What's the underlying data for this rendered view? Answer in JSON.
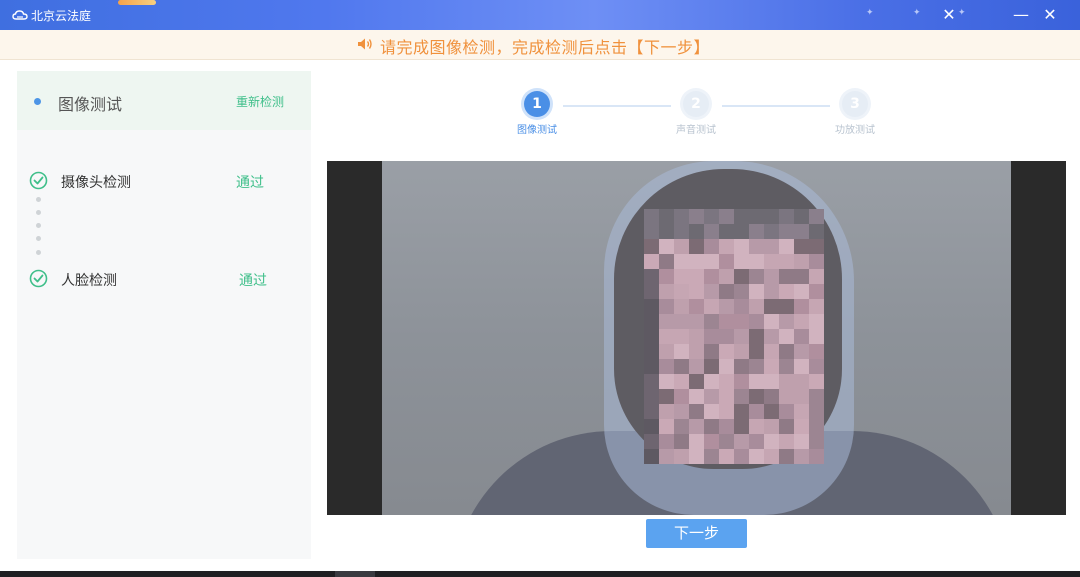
{
  "window": {
    "title": "北京云法庭",
    "minimize_icon": "minimize-icon",
    "close_icon": "close-icon",
    "minimize_label": "—",
    "close_label": "✕"
  },
  "notice": {
    "text": "请完成图像检测，完成检测后点击【下一步】",
    "icon": "speaker-icon",
    "color": "#f0913c"
  },
  "sidebar": {
    "section_title": "图像测试",
    "retest_label": "重新检测",
    "checks": [
      {
        "label": "摄像头检测",
        "status": "通过"
      },
      {
        "label": "人脸检测",
        "status": "通过"
      }
    ]
  },
  "stepper": {
    "active_index": 0,
    "steps": [
      {
        "number": "1",
        "label": "图像测试"
      },
      {
        "number": "2",
        "label": "声音测试"
      },
      {
        "number": "3",
        "label": "功放测试"
      }
    ]
  },
  "actions": {
    "next_label": "下一步"
  },
  "colors": {
    "accent": "#4a8fe6",
    "success": "#3fbf8a",
    "notice": "#f0913c",
    "button": "#5ba3f0"
  }
}
